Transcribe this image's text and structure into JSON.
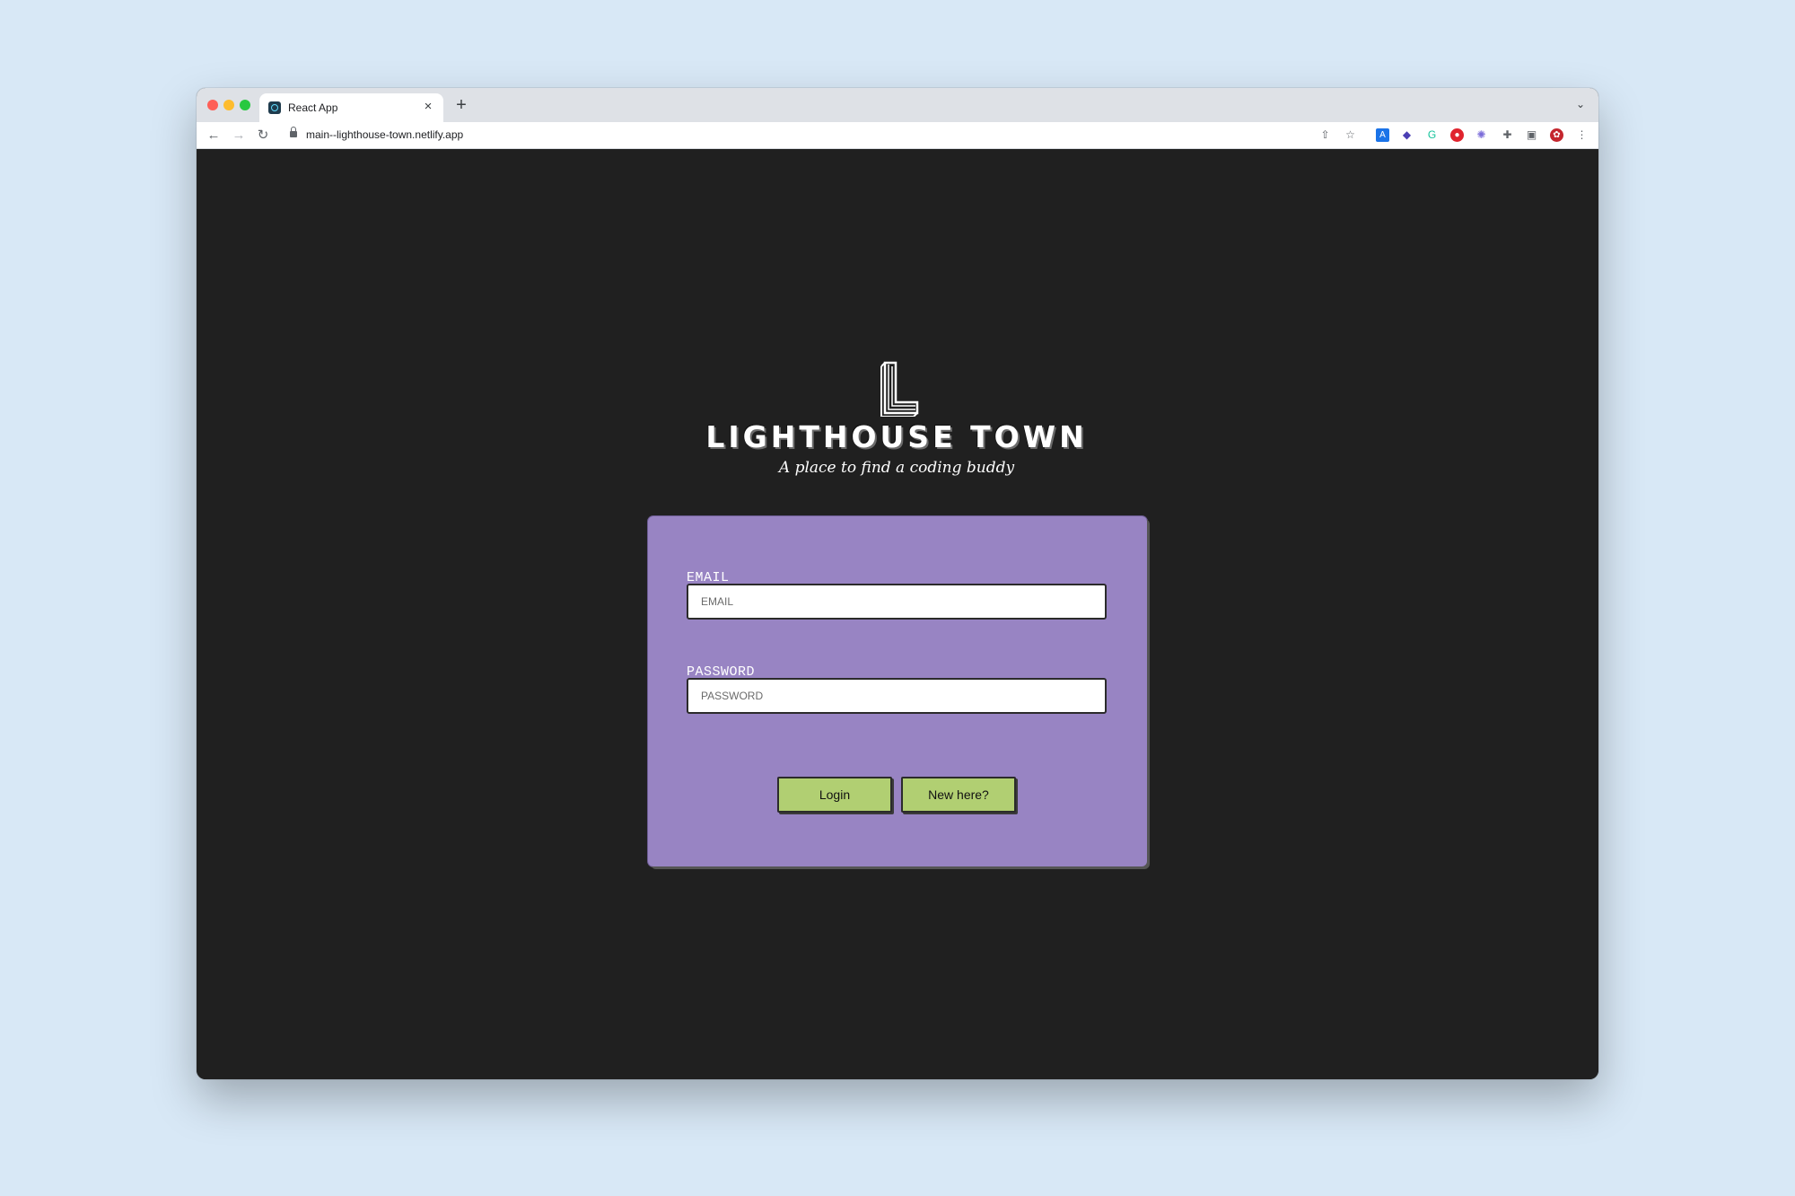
{
  "browser": {
    "tab_title": "React App",
    "tab_close": "×",
    "new_tab": "+",
    "tab_search": "⌄",
    "url": "main--lighthouse-town.netlify.app",
    "nav": {
      "back": "←",
      "forward": "→",
      "reload": "↻"
    },
    "extensions": [
      {
        "name": "share-icon",
        "glyph": "⇧"
      },
      {
        "name": "bookmark-star-icon",
        "glyph": "☆"
      },
      {
        "name": "translate-extension-icon",
        "glyph": "A"
      },
      {
        "name": "stacked-extension-icon",
        "glyph": "◆"
      },
      {
        "name": "grammarly-extension-icon",
        "glyph": "G"
      },
      {
        "name": "stop-extension-icon",
        "glyph": "●"
      },
      {
        "name": "react-devtools-extension-icon",
        "glyph": "✺"
      },
      {
        "name": "puzzle-extensions-icon",
        "glyph": "✚"
      },
      {
        "name": "side-panel-icon",
        "glyph": "▣"
      },
      {
        "name": "profile-extension-icon",
        "glyph": "✿"
      },
      {
        "name": "menu-kebab-icon",
        "glyph": "⋮"
      }
    ]
  },
  "branding": {
    "title": "LIGHTHOUSE TOWN",
    "tagline": "A place to find a coding buddy"
  },
  "login_form": {
    "email_label": "EMAIL",
    "email_placeholder": "EMAIL",
    "password_label": "PASSWORD",
    "password_placeholder": "PASSWORD",
    "login_button": "Login",
    "signup_button": "New here?"
  },
  "colors": {
    "page_bg": "#202020",
    "card_bg": "#9884c3",
    "button_bg": "#b1cf72",
    "desktop_bg": "#d8e8f6"
  }
}
